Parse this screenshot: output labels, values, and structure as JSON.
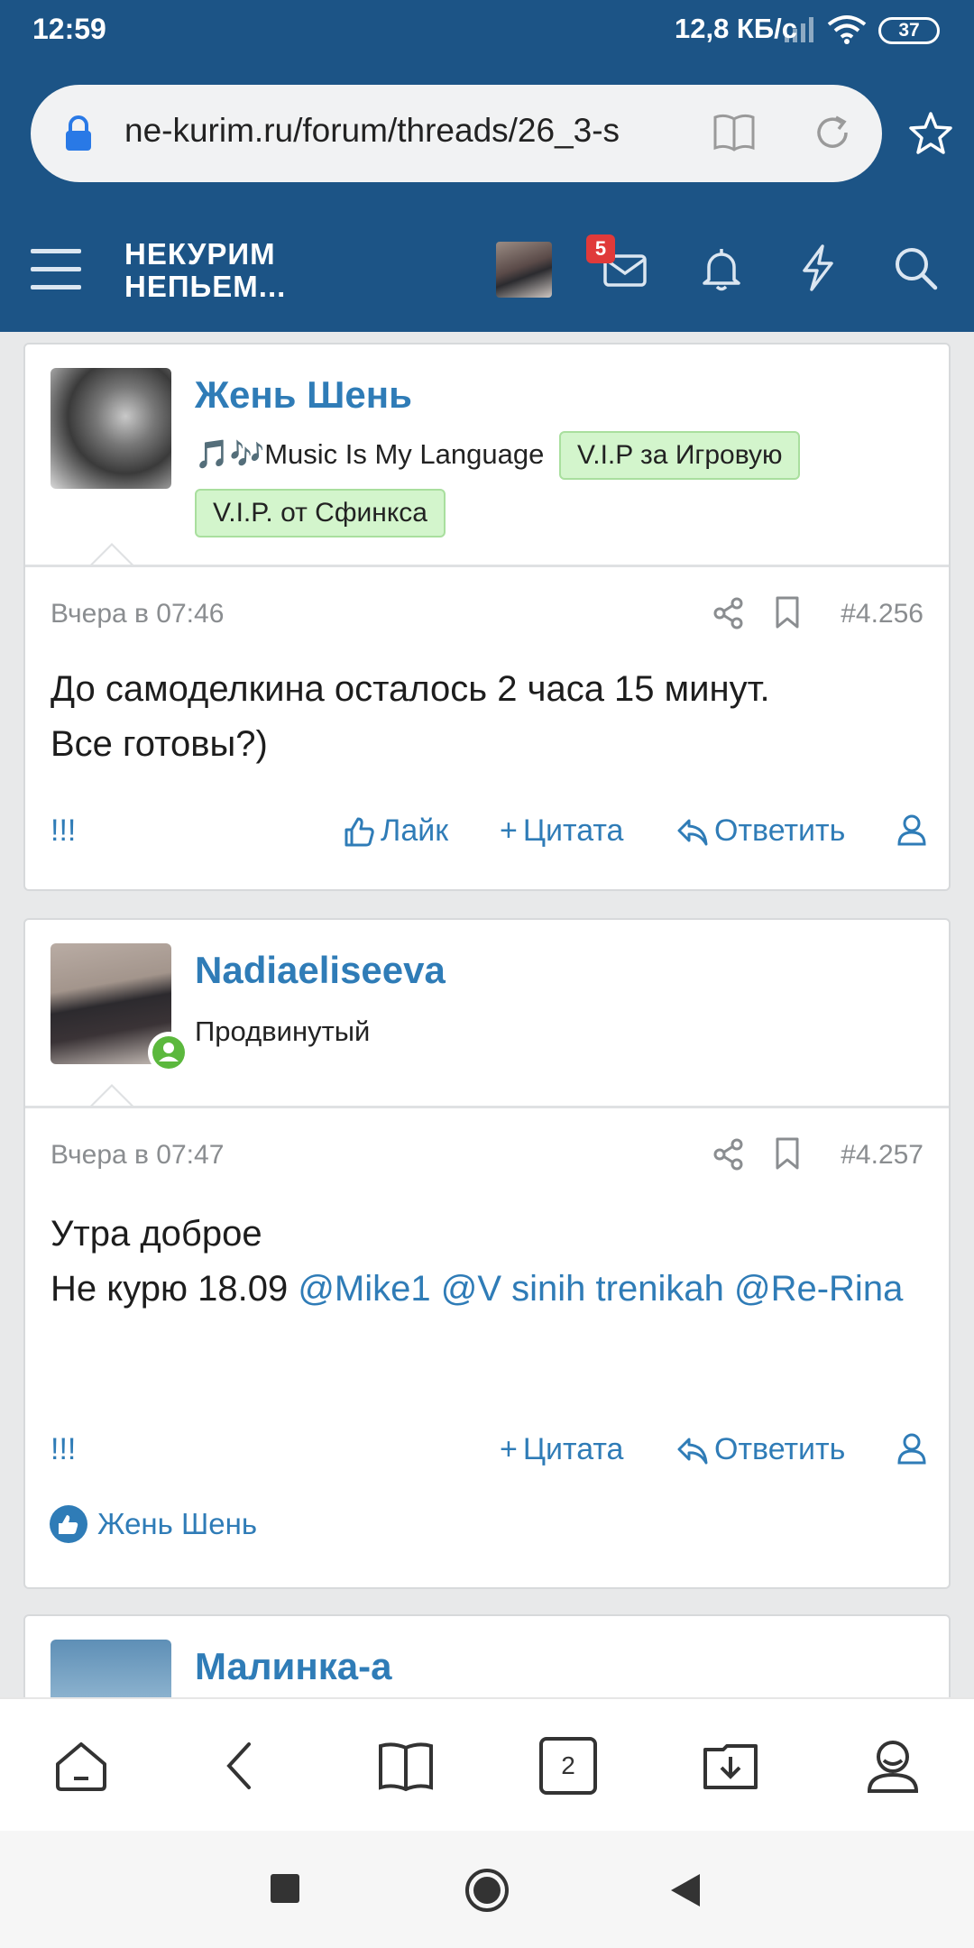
{
  "status_bar": {
    "time": "12:59",
    "net_speed": "12,8 КБ/с",
    "battery": "37"
  },
  "browser": {
    "url": "ne-kurim.ru/forum/threads/26_3-s",
    "tabs_count": "2"
  },
  "site_header": {
    "logo_line1": "НЕКУРИМ",
    "logo_line2": "НЕПЬЕМ...",
    "inbox_count": "5"
  },
  "posts": [
    {
      "username": "Жень Шень",
      "user_title": "🎵🎶Music Is My Language",
      "banners": [
        "V.I.P за Игровую",
        "V.I.P. от Сфинкса"
      ],
      "date": "Вчера в 07:46",
      "number": "#4.256",
      "body_line1": "До самоделкина осталось 2 часа 15 минут.",
      "body_line2": "Все готовы?)",
      "actions": {
        "report": "!!!",
        "like": "Лайк",
        "quote": "Цитата",
        "reply": "Ответить"
      }
    },
    {
      "username": "Nadiaeliseeva",
      "user_title": "Продвинутый",
      "date": "Вчера в 07:47",
      "number": "#4.257",
      "body_line1": "Утра доброе",
      "body_line2_prefix": "Не курю 18.09 ",
      "mentions": [
        "@Mike1",
        "@V sinih trenikah",
        "@Re-Rina"
      ],
      "actions": {
        "report": "!!!",
        "quote": "Цитата",
        "reply": "Ответить"
      },
      "liked_by": "Жень Шень"
    },
    {
      "username": "Малинка-а"
    }
  ],
  "colors": {
    "header_bg": "#1c5486",
    "link": "#2f7cb7",
    "banner_bg": "#d3f5cc",
    "badge": "#e03a3a"
  }
}
